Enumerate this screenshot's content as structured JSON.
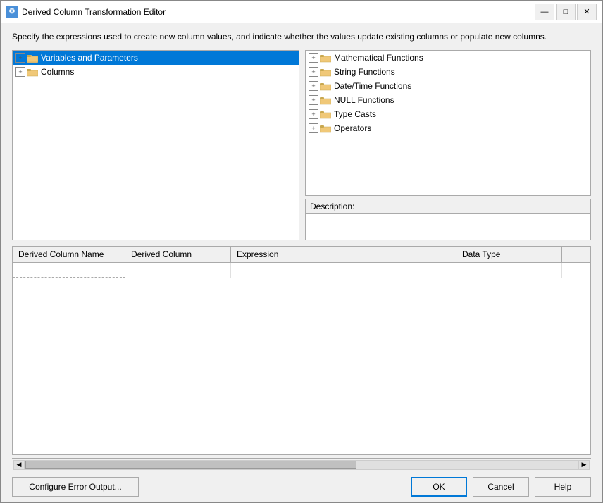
{
  "window": {
    "title": "Derived Column Transformation Editor",
    "icon": "D",
    "description": "Specify the expressions used to create new column values, and indicate whether the values update existing columns or populate new columns."
  },
  "title_buttons": {
    "minimize": "—",
    "maximize": "□",
    "close": "✕"
  },
  "left_tree": {
    "items": [
      {
        "id": "variables",
        "label": "Variables and Parameters",
        "expanded": true,
        "selected": true,
        "indent": 0
      },
      {
        "id": "columns",
        "label": "Columns",
        "expanded": false,
        "selected": false,
        "indent": 0
      }
    ]
  },
  "right_tree": {
    "items": [
      {
        "id": "math",
        "label": "Mathematical Functions",
        "expanded": false,
        "indent": 0
      },
      {
        "id": "string",
        "label": "String Functions",
        "expanded": false,
        "indent": 0
      },
      {
        "id": "datetime",
        "label": "Date/Time Functions",
        "expanded": false,
        "indent": 0
      },
      {
        "id": "null",
        "label": "NULL Functions",
        "expanded": false,
        "indent": 0
      },
      {
        "id": "casts",
        "label": "Type Casts",
        "expanded": false,
        "indent": 0
      },
      {
        "id": "operators",
        "label": "Operators",
        "expanded": false,
        "indent": 0
      }
    ]
  },
  "description_section": {
    "label": "Description:"
  },
  "grid": {
    "columns": [
      {
        "id": "name",
        "label": "Derived Column Name"
      },
      {
        "id": "derived",
        "label": "Derived Column"
      },
      {
        "id": "expression",
        "label": "Expression"
      },
      {
        "id": "datatype",
        "label": "Data Type"
      }
    ],
    "rows": []
  },
  "buttons": {
    "configure": "Configure Error Output...",
    "ok": "OK",
    "cancel": "Cancel",
    "help": "Help"
  }
}
